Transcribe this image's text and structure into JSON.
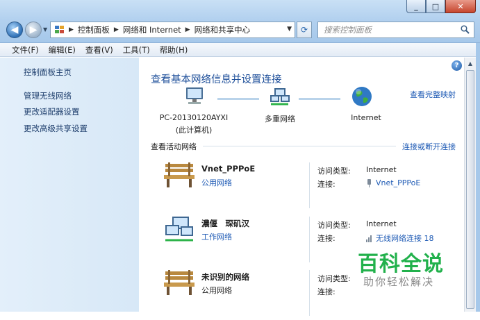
{
  "window": {
    "minimize_icon": "_",
    "maximize_icon": "□",
    "close_icon": "✕"
  },
  "address": {
    "crumbs": [
      "控制面板",
      "网络和 Internet",
      "网络和共享中心"
    ],
    "search_placeholder": "搜索控制面板"
  },
  "menu": [
    "文件(F)",
    "编辑(E)",
    "查看(V)",
    "工具(T)",
    "帮助(H)"
  ],
  "sidebar": {
    "items": [
      {
        "label": "控制面板主页"
      },
      {
        "label": "管理无线网络"
      },
      {
        "label": "更改适配器设置"
      },
      {
        "label": "更改高级共享设置"
      }
    ]
  },
  "main": {
    "title": "查看基本网络信息并设置连接",
    "view_full_map": "查看完整映射",
    "map": {
      "computer_name": "PC-20130120AYXI",
      "computer_sub": "(此计算机)",
      "network": "多重网络",
      "internet": "Internet"
    },
    "active_section_title": "查看活动网络",
    "connect_link": "连接或断开连接",
    "networks": [
      {
        "name": "Vnet_PPPoE",
        "category": "公用网络",
        "category_is_link": true,
        "icon": "bench-icon",
        "access_label": "访问类型:",
        "access_value": "Internet",
        "conn_label": "连接:",
        "conn_value": "Vnet_PPPoE",
        "conn_icon": "dialup-icon"
      },
      {
        "name": "濃偃　琛矶汉",
        "category": "工作网络",
        "category_is_link": true,
        "icon": "work-network-icon",
        "access_label": "访问类型:",
        "access_value": "Internet",
        "conn_label": "连接:",
        "conn_value": "无线网络连接 18",
        "conn_icon": "wireless-icon"
      },
      {
        "name": "未识别的网络",
        "category": "公用网络",
        "category_is_link": false,
        "icon": "bench-icon",
        "access_label": "访问类型:",
        "access_value": "",
        "conn_label": "连接:",
        "conn_value": "",
        "conn_icon": ""
      }
    ]
  },
  "watermark": {
    "title": "百科全说",
    "subtitle": "助你轻松解决"
  },
  "colors": {
    "link": "#1f5bb5",
    "title": "#1e4f9a",
    "watermark_green": "#22b14c"
  }
}
